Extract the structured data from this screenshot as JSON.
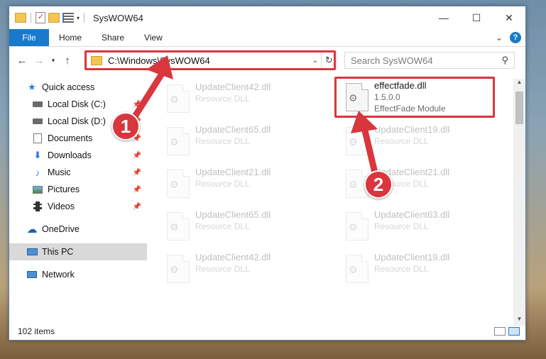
{
  "window": {
    "title": "SysWOW64"
  },
  "window_controls": {
    "minimize": "—",
    "maximize": "☐",
    "close": "✕"
  },
  "ribbon": {
    "file": "File",
    "tabs": [
      "Home",
      "Share",
      "View"
    ],
    "help": "?"
  },
  "nav": {
    "back": "←",
    "forward": "→",
    "recent": "▾",
    "up": "↑",
    "address": "C:\\Windows\\SysWOW64",
    "search_placeholder": "Search SysWOW64"
  },
  "sidebar": {
    "items": [
      {
        "label": "Quick access",
        "icon": "star-icon",
        "pinned": false
      },
      {
        "label": "Local Disk (C:)",
        "icon": "drive-icon",
        "pinned": true
      },
      {
        "label": "Local Disk (D:)",
        "icon": "drive-icon",
        "pinned": true
      },
      {
        "label": "Documents",
        "icon": "documents-icon",
        "pinned": true
      },
      {
        "label": "Downloads",
        "icon": "download-icon",
        "pinned": true
      },
      {
        "label": "Music",
        "icon": "music-icon",
        "pinned": true
      },
      {
        "label": "Pictures",
        "icon": "pictures-icon",
        "pinned": true
      },
      {
        "label": "Videos",
        "icon": "videos-icon",
        "pinned": true
      },
      {
        "label": "OneDrive",
        "icon": "cloud-icon",
        "pinned": false
      },
      {
        "label": "This PC",
        "icon": "computer-icon",
        "pinned": false,
        "selected": true
      },
      {
        "label": "Network",
        "icon": "network-icon",
        "pinned": false
      }
    ]
  },
  "files": {
    "col1": [
      {
        "name": "UpdateClient42.dll",
        "type": "Resource DLL"
      },
      {
        "name": "UpdateClient65.dll",
        "type": "Resource DLL"
      },
      {
        "name": "UpdateClient21.dll",
        "type": "Resource DLL"
      },
      {
        "name": "UpdateClient65.dll",
        "type": "Resource DLL"
      },
      {
        "name": "UpdateClient42.dll",
        "type": "Resource DLL"
      }
    ],
    "highlighted": {
      "name": "effectfade.dll",
      "version": "1.5.0.0",
      "description": "EffectFade Module"
    },
    "col2": [
      {
        "name": "UpdateClient19.dll",
        "type": "Resource DLL"
      },
      {
        "name": "UpdateClient21.dll",
        "type": "Resource DLL"
      },
      {
        "name": "UpdateClient63.dll",
        "type": "Resource DLL"
      },
      {
        "name": "UpdateClient19.dll",
        "type": "Resource DLL"
      }
    ]
  },
  "status": {
    "item_count": "102 items"
  },
  "callouts": {
    "step1": "1",
    "step2": "2",
    "color": "#d9363e"
  }
}
